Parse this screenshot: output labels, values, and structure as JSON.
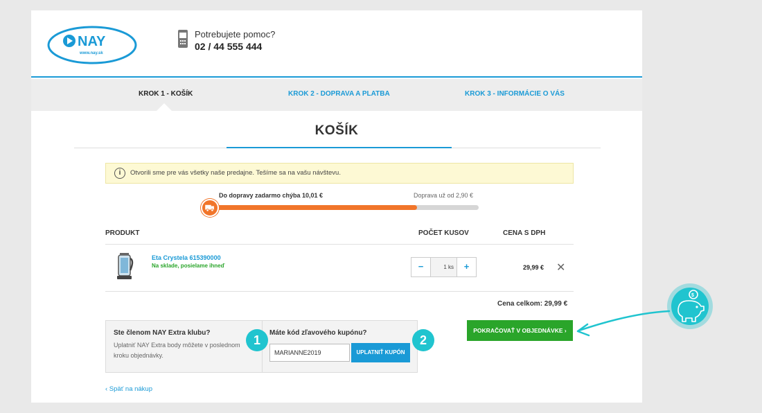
{
  "header": {
    "logo_text": "NAY",
    "logo_url_text": "www.nay.sk",
    "help_text": "Potrebujete pomoc?",
    "phone": "02 / 44 555 444"
  },
  "steps": [
    {
      "label": "KROK 1 - KOŠÍK",
      "active": true
    },
    {
      "label": "KROK 2 - DOPRAVA A PLATBA",
      "active": false
    },
    {
      "label": "KROK 3 - INFORMÁCIE O VÁS",
      "active": false
    }
  ],
  "page_title": "KOŠÍK",
  "notice": {
    "icon": "info-icon",
    "icon_glyph": "i",
    "text": "Otvorili sme pre vás všetky naše predajne. Tešíme sa na vašu návštevu."
  },
  "shipping": {
    "left_text": "Do dopravy zadarmo chýba 10,01 €",
    "right_text": "Doprava už od 2,90 €",
    "progress_fraction": 0.77
  },
  "table": {
    "col_product": "PRODUKT",
    "col_qty": "POČET KUSOV",
    "col_price": "CENA S DPH"
  },
  "item": {
    "name": "Eta Crystela 615390000",
    "stock": "Na sklade, posielame ihneď",
    "qty_minus": "−",
    "qty_plus": "+",
    "qty_value": "1 ks",
    "price": "29,99 €",
    "remove_glyph": "✕"
  },
  "total": "Cena celkom: 29,99 €",
  "club": {
    "title": "Ste členom NAY Extra klubu?",
    "text": "Uplatniť NAY Extra body môžete v poslednom kroku objednávky."
  },
  "coupon": {
    "title": "Máte kód zľavového kupónu?",
    "value": "MARIANNE2019",
    "button": "UPLATNIŤ KUPÓN"
  },
  "badges": [
    "1",
    "2"
  ],
  "continue_button": "POKRAČOVAŤ V OBJEDNÁVKE ›",
  "back_link": "‹ Späť na nákup",
  "colors": {
    "brand_blue": "#1a9ad6",
    "progress_orange": "#f1752a",
    "cta_green": "#2aa52a",
    "badge_teal": "#20c4cf"
  }
}
